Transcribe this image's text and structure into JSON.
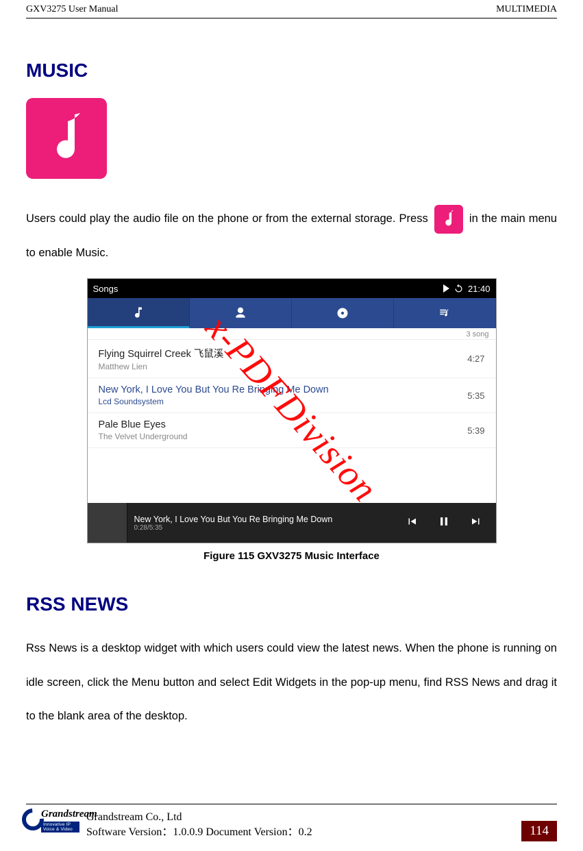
{
  "header": {
    "left": "GXV3275 User Manual",
    "right": "MULTIMEDIA"
  },
  "music": {
    "heading": "MUSIC",
    "para_before_icon": "Users could play the audio file on the phone or from the external storage. Press",
    "para_after_icon": "in the main menu to enable Music."
  },
  "screenshot": {
    "status_left": "Songs",
    "status_time": "21:40",
    "song_count": "3 song",
    "rows": [
      {
        "title": "Flying Squirrel Creek 飞鼠溪",
        "artist": "Matthew Lien",
        "duration": "4:27",
        "playing": false
      },
      {
        "title": "New York, I Love You But You Re Bringing Me Down",
        "artist": "Lcd Soundsystem",
        "duration": "5:35",
        "playing": true
      },
      {
        "title": "Pale Blue Eyes",
        "artist": "The Velvet Underground",
        "duration": "5:39",
        "playing": false
      }
    ],
    "now_playing": {
      "title": "New York, I Love You But You Re Bringing Me Down",
      "time": "0:28/5:35"
    }
  },
  "caption": "Figure 115 GXV3275 Music Interface",
  "rss": {
    "heading": "RSS NEWS",
    "para": "Rss News is a desktop widget with which users could view the latest news. When the phone is running on idle screen, click the Menu button and select Edit Widgets in the pop-up menu, find RSS News and drag it to the blank area of the desktop."
  },
  "watermark": "x-PDFDivision",
  "footer": {
    "company": "Grandstream Co., Ltd",
    "version": "Software Version：1.0.0.9 Document Version：0.2",
    "logo_name": "Grandstream",
    "logo_tag": "Innovative IP Voice & Video",
    "page": "114"
  }
}
